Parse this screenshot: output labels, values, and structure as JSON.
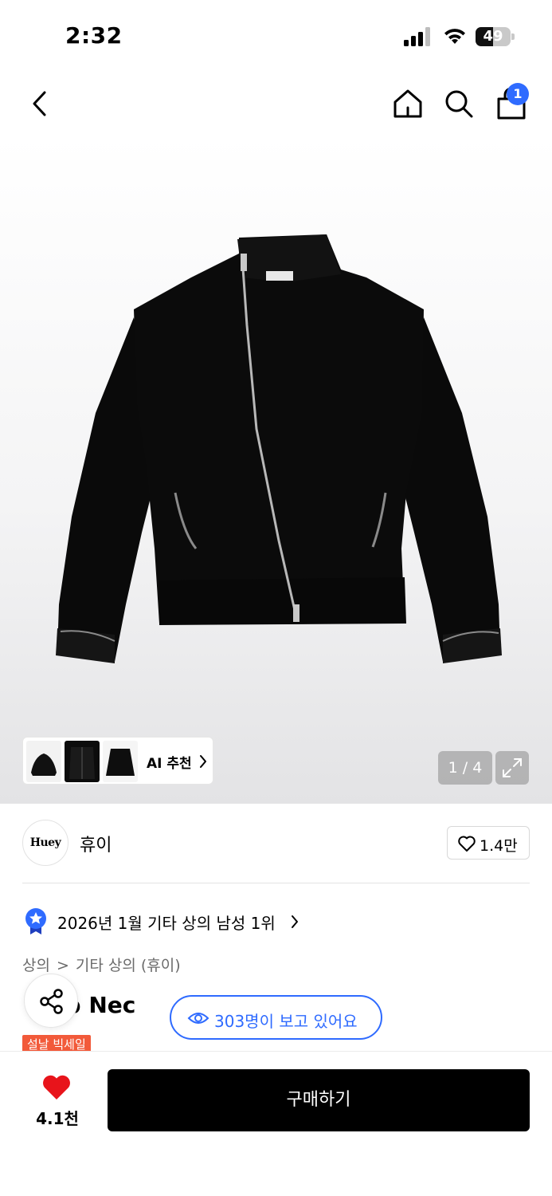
{
  "status_bar": {
    "time": "2:32",
    "battery": "49",
    "battery_level": 0.49
  },
  "nav": {
    "cart_count": "1"
  },
  "gallery": {
    "ai_label": "AI 추천",
    "page_indicator": "1 / 4",
    "current_page": 1,
    "total_pages": 4
  },
  "brand": {
    "logo_text": "Huey",
    "name": "휴이",
    "like_count": "1.4만"
  },
  "ranking": {
    "text": "2026년 1월 기타 상의 남성 1위"
  },
  "breadcrumb": {
    "level1": "상의",
    "separator": ">",
    "level2": "기타 상의 (휴이)"
  },
  "product": {
    "title_visible": "-Zip Nec",
    "sale_tag": "설날 빅세일"
  },
  "viewers": {
    "text": "303명이 보고 있어요"
  },
  "bottom_bar": {
    "wish_count": "4.1천",
    "buy_label": "구매하기"
  },
  "colors": {
    "accent_blue": "#2f6bff",
    "heart_red": "#e8141b",
    "sale_red": "#f25a3a"
  }
}
